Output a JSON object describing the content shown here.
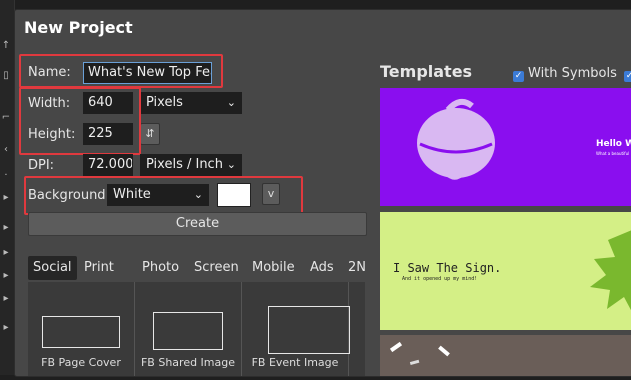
{
  "dialog": {
    "title": "New Project"
  },
  "form": {
    "name_label": "Name:",
    "name_value": "What's New Top Fea",
    "width_label": "Width:",
    "width_value": "640",
    "width_unit": "Pixels",
    "height_label": "Height:",
    "height_value": "225",
    "link_glyph": "⇵",
    "dpi_label": "DPI:",
    "dpi_value": "72.000",
    "dpi_unit": "Pixels / Inch",
    "background_label": "Background:",
    "background_value": "White",
    "swatch_color": "#ffffff",
    "more_button": "v",
    "create_label": "Create"
  },
  "tabs": [
    "Social",
    "Print",
    "Photo",
    "Screen",
    "Mobile",
    "Ads",
    "2N"
  ],
  "presets": [
    {
      "name": "FB Page Cover"
    },
    {
      "name": "FB Shared Image"
    },
    {
      "name": "FB Event Image"
    }
  ],
  "templates": {
    "title": "Templates",
    "with_symbols_label": "With Symbols",
    "items": [
      {
        "bg": "#8a0eef",
        "text": "Hello Wo",
        "subtext": "What a beautiful"
      },
      {
        "bg": "#d4ef86",
        "text": "I Saw The Sign.",
        "subtext": "And it opened up my mind!"
      },
      {
        "bg": "#6a5e58"
      }
    ]
  },
  "colors": {
    "accent_red": "#e0393e",
    "checkbox_blue": "#3b7bd6",
    "leaf_green": "#7ab82e"
  }
}
